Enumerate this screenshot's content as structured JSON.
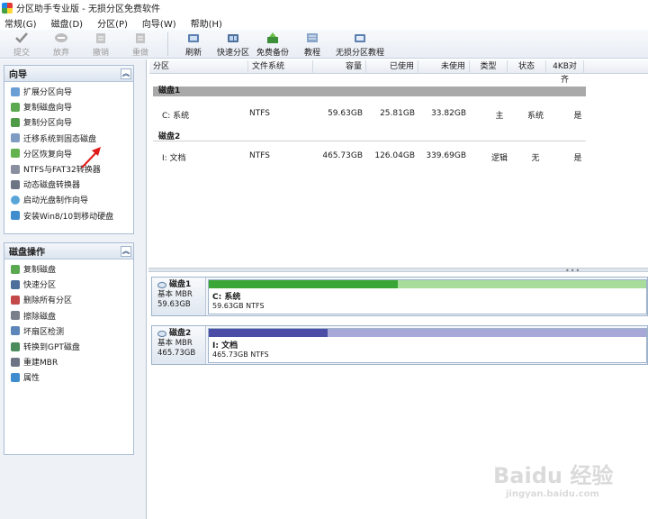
{
  "window": {
    "title": "分区助手专业版 - 无损分区免费软件"
  },
  "menu": [
    "常规(G)",
    "磁盘(D)",
    "分区(P)",
    "向导(W)",
    "帮助(H)"
  ],
  "toolbar": [
    {
      "label": "提交",
      "icon": "check-icon",
      "enabled": false
    },
    {
      "label": "放弃",
      "icon": "discard-icon",
      "enabled": false
    },
    {
      "label": "撤销",
      "icon": "undo-icon",
      "enabled": false
    },
    {
      "label": "重做",
      "icon": "redo-icon",
      "enabled": false
    },
    {
      "label": "刷新",
      "icon": "refresh-icon",
      "enabled": true
    },
    {
      "label": "快速分区",
      "icon": "quick-partition-icon",
      "enabled": true
    },
    {
      "label": "免费备份",
      "icon": "backup-icon",
      "enabled": true
    },
    {
      "label": "教程",
      "icon": "tutorial-icon",
      "enabled": true
    },
    {
      "label": "无损分区教程",
      "icon": "lossless-tutorial-icon",
      "enabled": true
    }
  ],
  "wizard_group": {
    "title": "向导",
    "items": [
      "扩展分区向导",
      "复制磁盘向导",
      "复制分区向导",
      "迁移系统到固态磁盘",
      "分区恢复向导",
      "NTFS与FAT32转换器",
      "动态磁盘转换器",
      "启动光盘制作向导",
      "安装Win8/10到移动硬盘"
    ]
  },
  "disk_ops_group": {
    "title": "磁盘操作",
    "items": [
      "复制磁盘",
      "快速分区",
      "删除所有分区",
      "擦除磁盘",
      "坏扇区检测",
      "转换到GPT磁盘",
      "重建MBR",
      "属性"
    ]
  },
  "table": {
    "columns": [
      "分区",
      "文件系统",
      "容量",
      "已使用",
      "未使用",
      "类型",
      "状态",
      "4KB对齐"
    ],
    "disks": [
      {
        "label": "磁盘1",
        "rows": [
          [
            "C: 系统",
            "NTFS",
            "59.63GB",
            "25.81GB",
            "33.82GB",
            "主",
            "系统",
            "是"
          ]
        ]
      },
      {
        "label": "磁盘2",
        "rows": [
          [
            "I: 文档",
            "NTFS",
            "465.73GB",
            "126.04GB",
            "339.69GB",
            "逻辑",
            "无",
            "是"
          ]
        ]
      }
    ]
  },
  "disk_map": [
    {
      "name": "磁盘1",
      "type": "基本 MBR",
      "size": "59.63GB",
      "part_name": "C: 系统",
      "part_info": "59.63GB NTFS",
      "used_fraction": 0.433,
      "color": "#3aa635",
      "free_color": "#a7dc9b"
    },
    {
      "name": "磁盘2",
      "type": "基本 MBR",
      "size": "465.73GB",
      "part_name": "I: 文档",
      "part_info": "465.73GB NTFS",
      "used_fraction": 0.271,
      "color": "#4b4ca6",
      "free_color": "#a7a8d8"
    }
  ],
  "watermark": {
    "main": "Baidu 经验",
    "url": "jingyan.baidu.com"
  }
}
